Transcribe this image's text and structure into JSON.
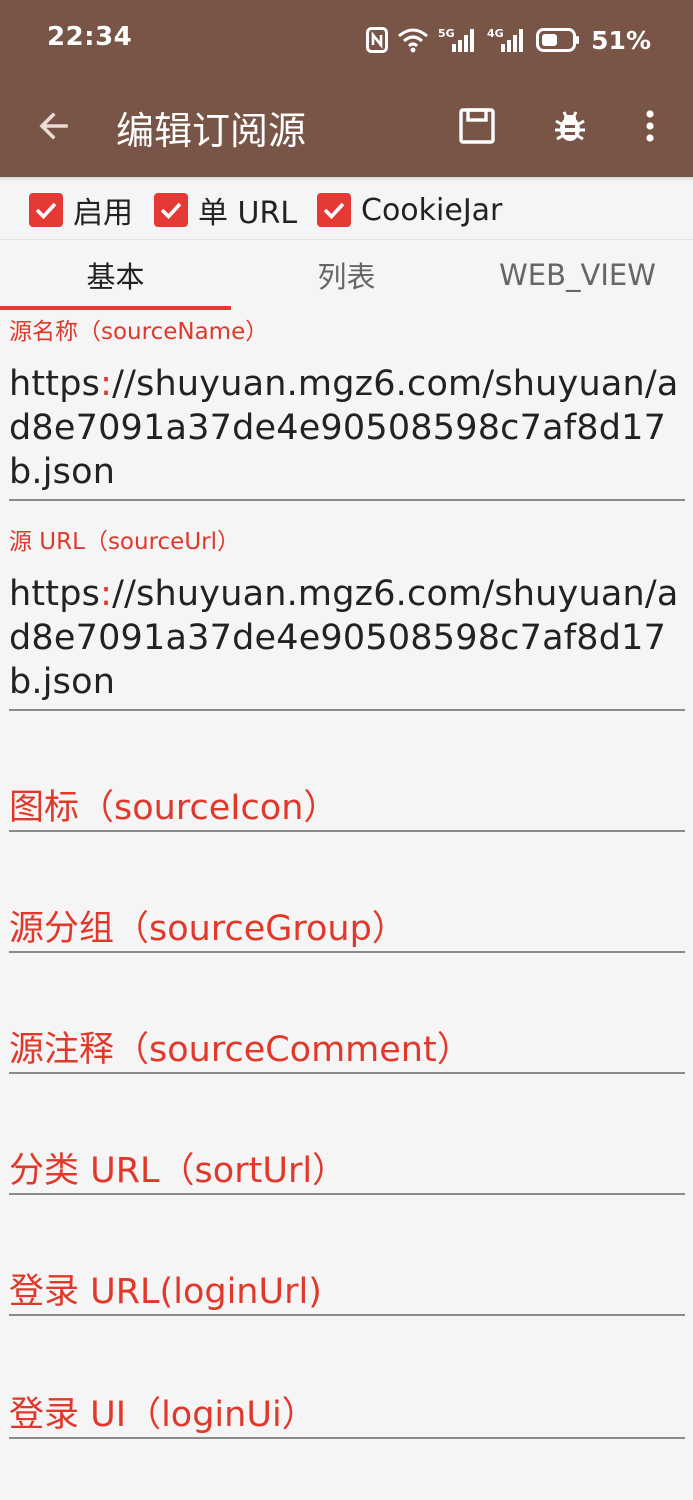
{
  "status_bar": {
    "time": "22:34",
    "battery_percent": "51%",
    "signal_1_label": "5G",
    "signal_2_label": "4G",
    "icons": [
      "nfc-icon",
      "wifi-icon",
      "signal-5g-icon",
      "signal-4g-icon",
      "battery-icon"
    ]
  },
  "toolbar": {
    "title": "编辑订阅源",
    "back_icon": "arrow-left-icon",
    "save_icon": "save-icon",
    "debug_icon": "bug-icon",
    "more_icon": "more-vert-icon",
    "background_color": "#795548"
  },
  "checkboxes": [
    {
      "label": "启用",
      "checked": true
    },
    {
      "label": "单 URL",
      "checked": true
    },
    {
      "label": "CookieJar",
      "checked": true
    }
  ],
  "tabs": [
    {
      "label": "基本",
      "active": true
    },
    {
      "label": "列表",
      "active": false
    },
    {
      "label": "WEB_VIEW",
      "active": false
    }
  ],
  "fields": {
    "source_name": {
      "label": "源名称（sourceName）",
      "value_prefix": "https",
      "value_colon": ":",
      "value_rest": "//shuyuan.mgz6.com/shuyuan/ad8e7091a37de4e90508598c7af8d17b.json"
    },
    "source_url": {
      "label": "源 URL（sourceUrl）",
      "value_prefix": "https",
      "value_colon": ":",
      "value_rest": "//shuyuan.mgz6.com/shuyuan/ad8e7091a37de4e90508598c7af8d17b.json"
    },
    "source_icon": {
      "hint": "图标（sourceIcon）"
    },
    "source_group": {
      "hint": "源分组（sourceGroup）"
    },
    "source_comment": {
      "hint": "源注释（sourceComment）"
    },
    "sort_url": {
      "hint": "分类 URL（sortUrl）"
    },
    "login_url": {
      "hint": "登录 URL(loginUrl)"
    },
    "login_ui": {
      "hint": "登录 UI（loginUi）"
    }
  },
  "colors": {
    "accent": "#e53935",
    "label": "#e0392b",
    "text": "#222222",
    "background": "#f5f5f5"
  }
}
